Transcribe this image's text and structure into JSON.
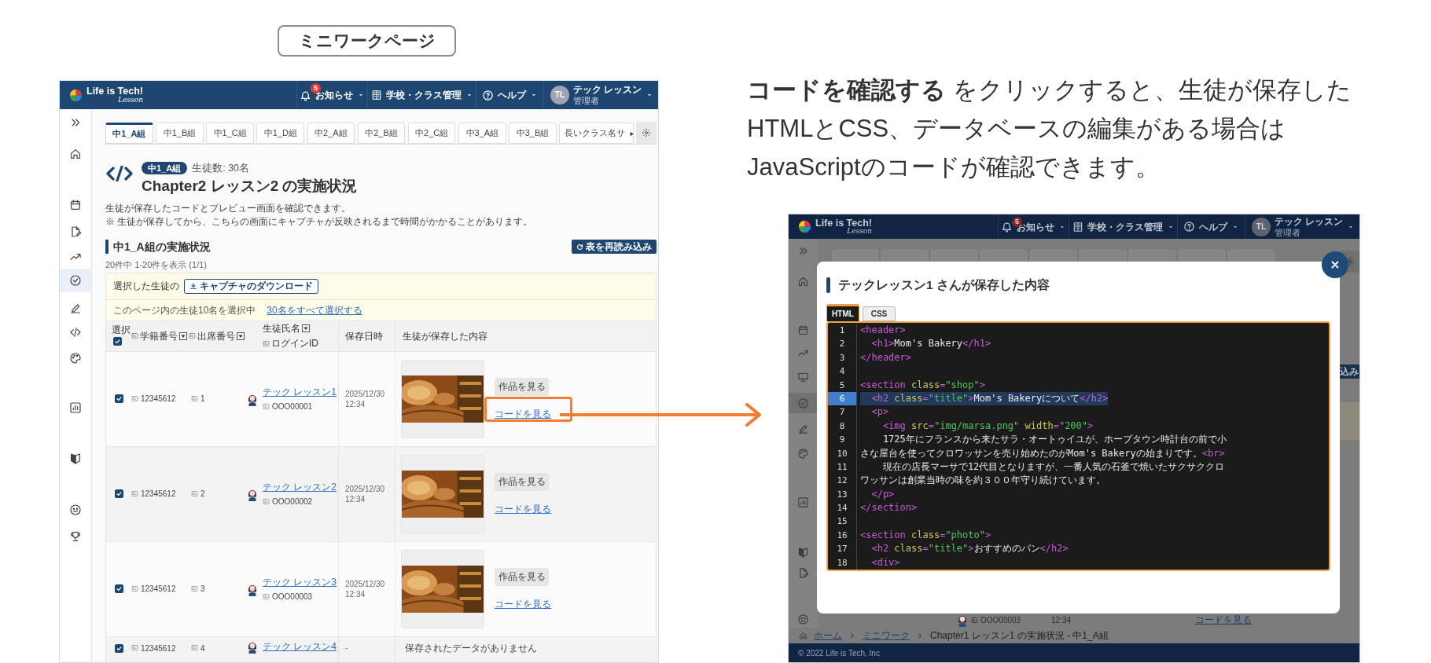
{
  "page_label": "ミニワークページ",
  "left_screen": {
    "header": {
      "logo": "Life is Tech!",
      "logo_sub": "Lesson",
      "notifications": {
        "label": "お知らせ",
        "count": "5"
      },
      "school_menu": "学校・クラス管理",
      "help_menu": "ヘルプ",
      "user": {
        "initials": "TL",
        "name": "テック レッスン",
        "role": "管理者"
      }
    },
    "sidebar": {
      "items": [
        {
          "selected": false
        },
        {
          "selected": false
        },
        {
          "selected": false
        },
        {
          "selected": false
        },
        {
          "selected": false
        },
        {
          "selected": true
        },
        {
          "selected": false
        },
        {
          "selected": false
        },
        {
          "selected": false
        },
        {
          "selected": false
        },
        {
          "selected": false
        },
        {
          "selected": false
        },
        {
          "selected": false
        }
      ]
    },
    "tabs": [
      {
        "label": "中1_A組",
        "selected": true
      },
      {
        "label": "中1_B組",
        "selected": false
      },
      {
        "label": "中1_C組",
        "selected": false
      },
      {
        "label": "中1_D組",
        "selected": false
      },
      {
        "label": "中2_A組",
        "selected": false
      },
      {
        "label": "中2_B組",
        "selected": false
      },
      {
        "label": "中2_C組",
        "selected": false
      },
      {
        "label": "中3_A組",
        "selected": false
      },
      {
        "label": "中3_B組",
        "selected": false
      },
      {
        "label": "長いクラス名サ",
        "selected": false
      }
    ],
    "heading": {
      "badge": "中1_A組",
      "count": "生徒数: 30名",
      "title": "Chapter2 レッスン2 の実施状況"
    },
    "description": [
      "生徒が保存したコードとプレビュー画面を確認できます。",
      "※ 生徒が保存してから、こちらの画面にキャプチャが反映されるまで時間がかかることがあります。"
    ],
    "section_title": "中1_A組の実施状況",
    "reload_button": "表を再読み込み",
    "result_count": "20件中 1-20件を表示 (1/1)",
    "selection_bar": {
      "prefix": "選択した生徒の",
      "download_button": "キャプチャのダウンロード",
      "status": "このページ内の生徒10名を選択中",
      "select_all_link": "30名をすべて選択する"
    },
    "table": {
      "header": {
        "select_label": "選択",
        "all_checked": true,
        "student_number": "学籍番号",
        "attendance_number": "出席番号",
        "name": "生徒氏名",
        "login_id": "ログインID",
        "saved_at": "保存日時",
        "content": "生徒が保存した内容"
      },
      "rows": [
        {
          "checked": true,
          "student_number": "12345612",
          "attendance_number": "1",
          "name": "テック レッスン1",
          "login_id": "OOO00001",
          "saved_date": "2025/12/30",
          "saved_time": "12:34",
          "saved": true,
          "view_button": "作品を見る",
          "code_link": "コードを見る",
          "highlighted": true
        },
        {
          "checked": true,
          "student_number": "12345612",
          "attendance_number": "2",
          "name": "テック レッスン2",
          "login_id": "OOO00002",
          "saved_date": "2025/12/30",
          "saved_time": "12:34",
          "saved": true,
          "view_button": "作品を見る",
          "code_link": "コードを見る",
          "highlighted": false
        },
        {
          "checked": true,
          "student_number": "12345612",
          "attendance_number": "3",
          "name": "テック レッスン3",
          "login_id": "OOO00003",
          "saved_date": "2025/12/30",
          "saved_time": "12:34",
          "saved": true,
          "view_button": "作品を見る",
          "code_link": "コードを見る",
          "highlighted": false
        },
        {
          "checked": true,
          "student_number": "12345612",
          "attendance_number": "4",
          "name": "テック レッスン4",
          "saved_date": "-",
          "saved": false,
          "empty_message": "保存されたデータがありません",
          "highlighted": false
        }
      ]
    }
  },
  "caption": "**コードを確認する** をクリックすると、生徒が保存した\nHTMLとCSS、データベースの編集がある場合は\nJavaScriptのコードが確認できます。",
  "right_screen": {
    "header": {
      "logo": "Life is Tech!",
      "logo_sub": "Lesson",
      "notifications": {
        "label": "お知らせ",
        "count": "5"
      },
      "school_menu": "学校・クラス管理",
      "help_menu": "ヘルプ",
      "user": {
        "initials": "TL",
        "name": "テック レッスン",
        "role": "管理者"
      }
    },
    "sidebar": {
      "items": [
        {
          "selected": false
        },
        {
          "selected": false
        },
        {
          "selected": false
        },
        {
          "selected": false
        },
        {
          "selected": false
        },
        {
          "selected": true
        },
        {
          "selected": false
        },
        {
          "selected": false
        },
        {
          "selected": false
        },
        {
          "selected": false
        },
        {
          "selected": false
        },
        {
          "selected": false
        }
      ]
    },
    "reload_fragment": "込み",
    "modal": {
      "title": "テックレッスン1 さんが保存した内容",
      "tabs": [
        {
          "label": "HTML",
          "selected": true
        },
        {
          "label": "CSS",
          "selected": false
        }
      ],
      "code_lines": [
        {
          "number": "1",
          "selected": false,
          "tokens": [
            {
              "kind": "tag",
              "text": "<header>"
            }
          ]
        },
        {
          "number": "2",
          "selected": false,
          "tokens": [
            {
              "kind": "tag",
              "text": "  <h1>"
            },
            {
              "kind": "text",
              "text": "Mom's Bakery"
            },
            {
              "kind": "tag",
              "text": "</h1>"
            }
          ]
        },
        {
          "number": "3",
          "selected": false,
          "tokens": [
            {
              "kind": "tag",
              "text": "</header>"
            }
          ]
        },
        {
          "number": "4",
          "selected": false
        },
        {
          "number": "5",
          "selected": false,
          "tokens": [
            {
              "kind": "tag",
              "text": "<section "
            },
            {
              "kind": "attr",
              "text": "class"
            },
            {
              "kind": "tag",
              "text": "="
            },
            {
              "kind": "string",
              "text": "\"shop\""
            },
            {
              "kind": "tag",
              "text": ">"
            }
          ]
        },
        {
          "number": "6",
          "selected": true,
          "tokens": [
            {
              "kind": "tag",
              "text": "  <h2 "
            },
            {
              "kind": "attr",
              "text": "class"
            },
            {
              "kind": "tag",
              "text": "="
            },
            {
              "kind": "string",
              "text": "\"title\""
            },
            {
              "kind": "tag",
              "text": ">"
            },
            {
              "kind": "text",
              "text": "Mom's Bakeryについて"
            },
            {
              "kind": "tag",
              "text": "</h2>"
            }
          ]
        },
        {
          "number": "7",
          "selected": false,
          "tokens": [
            {
              "kind": "tag",
              "text": "  <p>"
            }
          ]
        },
        {
          "number": "8",
          "selected": false,
          "tokens": [
            {
              "kind": "tag",
              "text": "    <img "
            },
            {
              "kind": "attr",
              "text": "src"
            },
            {
              "kind": "tag",
              "text": "="
            },
            {
              "kind": "string",
              "text": "\"img/marsa.png\""
            },
            {
              "kind": "attr",
              "text": " width"
            },
            {
              "kind": "tag",
              "text": "="
            },
            {
              "kind": "string",
              "text": "\"200\""
            },
            {
              "kind": "tag",
              "text": ">"
            }
          ]
        },
        {
          "number": "9",
          "selected": false,
          "tokens": [
            {
              "kind": "text",
              "text": "    1725年にフランスから来たサラ・オートゥイユが、ホープタウン時計台の前で小"
            }
          ]
        },
        {
          "number": "10",
          "selected": false,
          "tokens": [
            {
              "kind": "text",
              "text": "さな屋台を使ってクロワッサンを売り始めたのがMom's Bakeryの始まりです。"
            },
            {
              "kind": "tag",
              "text": "<br>"
            }
          ]
        },
        {
          "number": "11",
          "selected": false,
          "tokens": [
            {
              "kind": "text",
              "text": "    現在の店長マーサで12代目となりますが、一番人気の石釜で焼いたサクサククロ"
            }
          ]
        },
        {
          "number": "12",
          "selected": false,
          "tokens": [
            {
              "kind": "text",
              "text": "ワッサンは創業当時の味を約３００年守り続けています。"
            }
          ]
        },
        {
          "number": "13",
          "selected": false,
          "tokens": [
            {
              "kind": "tag",
              "text": "  </p>"
            }
          ]
        },
        {
          "number": "14",
          "selected": false,
          "tokens": [
            {
              "kind": "tag",
              "text": "</section>"
            }
          ]
        },
        {
          "number": "15",
          "selected": false
        },
        {
          "number": "16",
          "selected": false,
          "tokens": [
            {
              "kind": "tag",
              "text": "<section "
            },
            {
              "kind": "attr",
              "text": "class"
            },
            {
              "kind": "tag",
              "text": "="
            },
            {
              "kind": "string",
              "text": "\"photo\""
            },
            {
              "kind": "tag",
              "text": ">"
            }
          ]
        },
        {
          "number": "17",
          "selected": false,
          "tokens": [
            {
              "kind": "tag",
              "text": "  <h2 "
            },
            {
              "kind": "attr",
              "text": "class"
            },
            {
              "kind": "tag",
              "text": "="
            },
            {
              "kind": "string",
              "text": "\"title\""
            },
            {
              "kind": "tag",
              "text": ">"
            },
            {
              "kind": "text",
              "text": "おすすめのパン"
            },
            {
              "kind": "tag",
              "text": "</h2>"
            }
          ]
        },
        {
          "number": "18",
          "selected": false,
          "tokens": [
            {
              "kind": "tag",
              "text": "  <div>"
            }
          ]
        }
      ]
    },
    "background_row": {
      "login_id": "OOO00003",
      "saved_time": "12:34",
      "code_link": "コードを見る"
    },
    "breadcrumb": [
      {
        "label": "ホーム",
        "link": true
      },
      {
        "label": "ミニワーク",
        "link": true
      },
      {
        "label": "Chapter1 レッスン1 の実施状況 - 中1_A組",
        "link": false
      }
    ],
    "footer": "© 2022 Life is Tech, Inc"
  }
}
